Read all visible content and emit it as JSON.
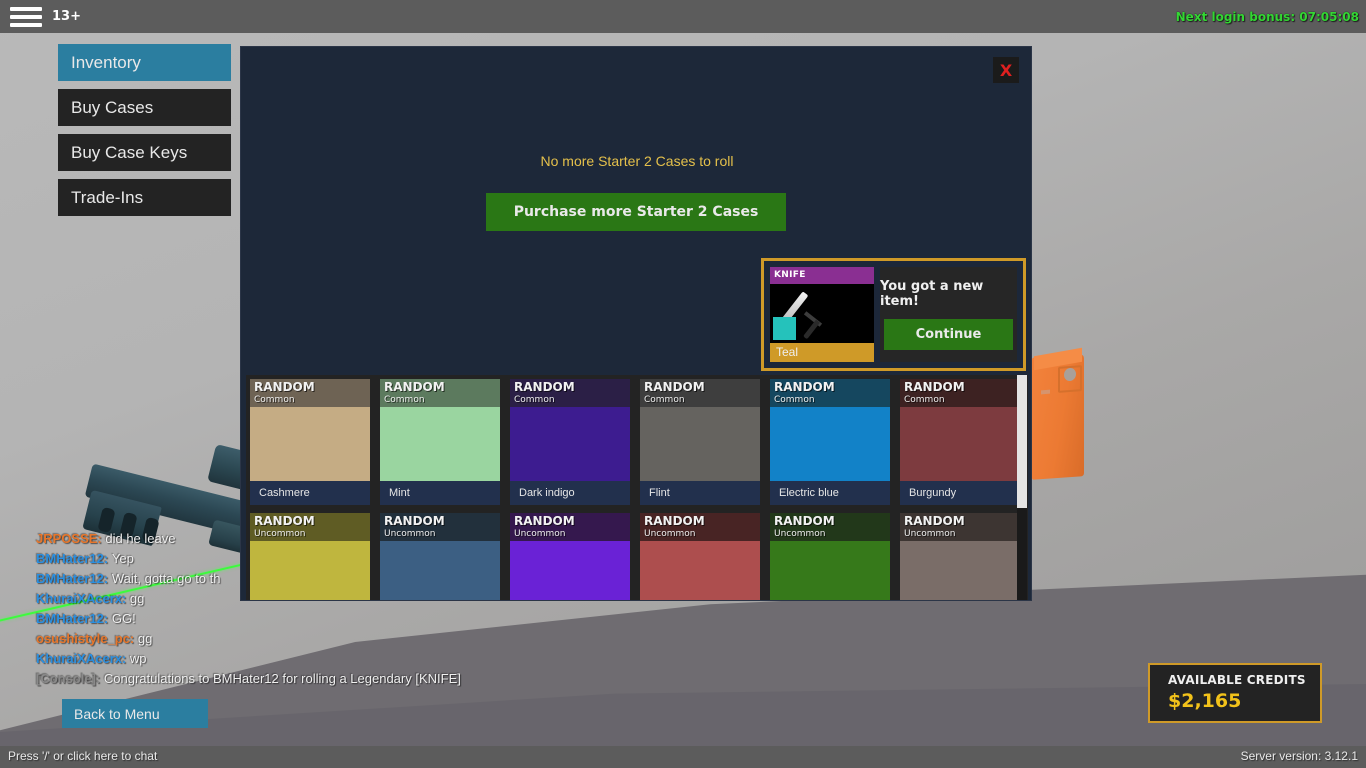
{
  "topbar": {
    "menu_icon": "hamburger-icon",
    "age_rating": "13+",
    "login_bonus": "Next login bonus: 07:05:08",
    "login_bonus_color": "#34d634"
  },
  "sidebar": {
    "items": [
      {
        "label": "Inventory",
        "active": true
      },
      {
        "label": "Buy Cases",
        "active": false
      },
      {
        "label": "Buy Case Keys",
        "active": false
      },
      {
        "label": "Trade-Ins",
        "active": false
      }
    ],
    "active_color": "#2b7ea0"
  },
  "panel": {
    "close_label": "X",
    "close_color": "#e02020",
    "roll_message": "No more Starter 2 Cases to roll",
    "roll_message_color": "#e4c04b",
    "purchase_button": "Purchase more Starter 2 Cases",
    "purchase_button_color": "#2a7715"
  },
  "new_item_popup": {
    "title": "You got a new item!",
    "continue_label": "Continue",
    "border_color": "#cf9a28",
    "card": {
      "type": "KNIFE",
      "type_bg": "#8a2f92",
      "name": "Teal",
      "swatch_color": "#25c2bb",
      "icon": "knife-icon"
    }
  },
  "inventory": {
    "rows": [
      [
        {
          "type": "RANDOM",
          "rarity": "Common",
          "name": "Cashmere",
          "header_color": "#6e6354",
          "swatch_color": "#c5ac84"
        },
        {
          "type": "RANDOM",
          "rarity": "Common",
          "name": "Mint",
          "header_color": "#5c7a5e",
          "swatch_color": "#9ad5a0"
        },
        {
          "type": "RANDOM",
          "rarity": "Common",
          "name": "Dark indigo",
          "header_color": "#2b1f46",
          "swatch_color": "#3d1c90"
        },
        {
          "type": "RANDOM",
          "rarity": "Common",
          "name": "Flint",
          "header_color": "#3e3e3e",
          "swatch_color": "#65635f"
        },
        {
          "type": "RANDOM",
          "rarity": "Common",
          "name": "Electric blue",
          "header_color": "#15475f",
          "swatch_color": "#1282c8"
        },
        {
          "type": "RANDOM",
          "rarity": "Common",
          "name": "Burgundy",
          "header_color": "#3d2222",
          "swatch_color": "#7d3b3f"
        }
      ],
      [
        {
          "type": "RANDOM",
          "rarity": "Uncommon",
          "name": "",
          "header_color": "#5f5c24",
          "swatch_color": "#bfb63e"
        },
        {
          "type": "RANDOM",
          "rarity": "Uncommon",
          "name": "",
          "header_color": "#22303c",
          "swatch_color": "#3c5f83"
        },
        {
          "type": "RANDOM",
          "rarity": "Uncommon",
          "name": "",
          "header_color": "#35184e",
          "swatch_color": "#6a22d6"
        },
        {
          "type": "RANDOM",
          "rarity": "Uncommon",
          "name": "",
          "header_color": "#482424",
          "swatch_color": "#ad4e4e"
        },
        {
          "type": "RANDOM",
          "rarity": "Uncommon",
          "name": "",
          "header_color": "#22381a",
          "swatch_color": "#36791a"
        },
        {
          "type": "RANDOM",
          "rarity": "Uncommon",
          "name": "",
          "header_color": "#3d3532",
          "swatch_color": "#7a6d68"
        }
      ]
    ]
  },
  "chat": {
    "lines": [
      {
        "name": "JRPOSSE",
        "color": "orange",
        "text": "did he leave"
      },
      {
        "name": "BMHater12",
        "color": "blue",
        "text": "Yep"
      },
      {
        "name": "BMHater12",
        "color": "blue",
        "text": "Wait, gotta go to th",
        "clipped": true
      },
      {
        "name": "KhuraiXAcerx",
        "color": "blue",
        "text": "gg"
      },
      {
        "name": "BMHater12",
        "color": "blue",
        "text": "GG!"
      },
      {
        "name": "osushistyle_pc",
        "color": "orange",
        "text": "gg"
      },
      {
        "name": "KhuraiXAcerx",
        "color": "blue",
        "text": "wp"
      },
      {
        "name": "[Console]",
        "color": "console",
        "text": "Congratulations to BMHater12 for rolling a Legendary [KNIFE]"
      }
    ],
    "back_to_menu": "Back to Menu",
    "prompt": "Press '/' or click here to chat"
  },
  "credits": {
    "label": "AVAILABLE CREDITS",
    "value": "$2,165",
    "value_color": "#f2c21a",
    "border_color": "#cf9a28"
  },
  "footer": {
    "server_version": "Server version: 3.12.1"
  }
}
